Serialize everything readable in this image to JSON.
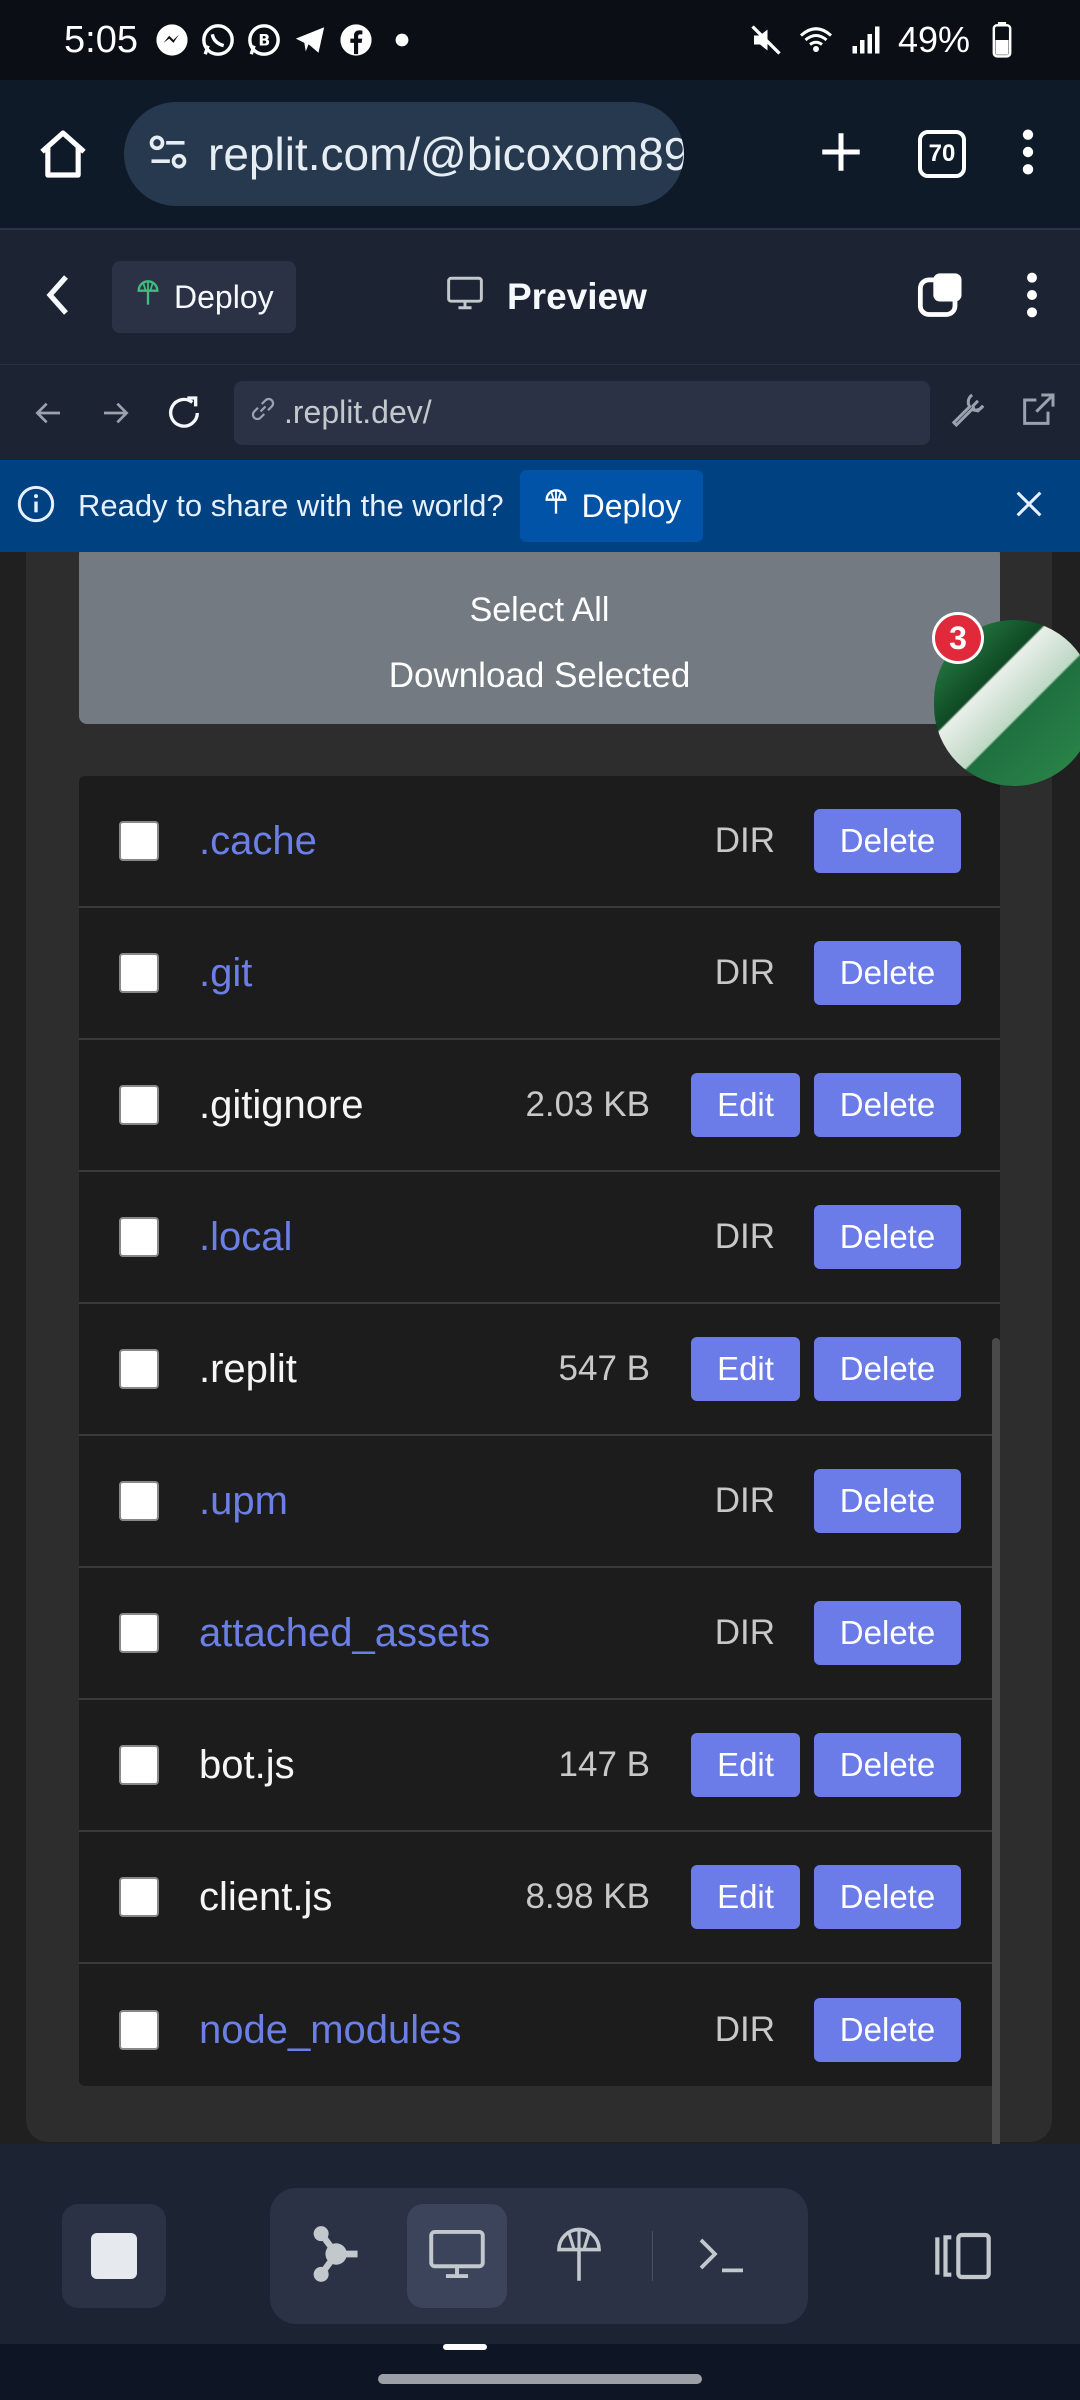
{
  "status_bar": {
    "time": "5:05",
    "battery": "49%",
    "left_icons": [
      "messenger-icon",
      "whatsapp-icon",
      "whatsapp-business-icon",
      "telegram-icon",
      "facebook-icon",
      "dot-icon"
    ],
    "right_icons": [
      "mute-icon",
      "wifi-icon",
      "signal-icon",
      "battery-icon"
    ]
  },
  "browser": {
    "url": "replit.com/@bicoxom89",
    "tab_count": "70"
  },
  "replit_header": {
    "deploy_label": "Deploy",
    "preview_label": "Preview"
  },
  "nav_bar": {
    "address": ".replit.dev/"
  },
  "banner": {
    "text": "Ready to share with the world?",
    "deploy_label": "Deploy"
  },
  "page": {
    "select_all_label": "Select All",
    "download_label": "Download Selected",
    "files": [
      {
        "name": ".cache",
        "type": "dir",
        "size": "DIR",
        "editable": false,
        "delete_label": "Delete"
      },
      {
        "name": ".git",
        "type": "dir",
        "size": "DIR",
        "editable": false,
        "delete_label": "Delete"
      },
      {
        "name": ".gitignore",
        "type": "file",
        "size": "2.03 KB",
        "editable": true,
        "edit_label": "Edit",
        "delete_label": "Delete"
      },
      {
        "name": ".local",
        "type": "dir",
        "size": "DIR",
        "editable": false,
        "delete_label": "Delete"
      },
      {
        "name": ".replit",
        "type": "file",
        "size": "547 B",
        "editable": true,
        "edit_label": "Edit",
        "delete_label": "Delete"
      },
      {
        "name": ".upm",
        "type": "dir",
        "size": "DIR",
        "editable": false,
        "delete_label": "Delete"
      },
      {
        "name": "attached_assets",
        "type": "dir",
        "size": "DIR",
        "editable": false,
        "delete_label": "Delete"
      },
      {
        "name": "bot.js",
        "type": "file",
        "size": "147 B",
        "editable": true,
        "edit_label": "Edit",
        "delete_label": "Delete"
      },
      {
        "name": "client.js",
        "type": "file",
        "size": "8.98 KB",
        "editable": true,
        "edit_label": "Edit",
        "delete_label": "Delete"
      },
      {
        "name": "node_modules",
        "type": "dir",
        "size": "DIR",
        "editable": false,
        "delete_label": "Delete"
      }
    ]
  },
  "bubble": {
    "badge_count": "3"
  },
  "colors": {
    "accent": "#6b7be8",
    "dir_link": "#6b7fe6",
    "banner": "#004182",
    "notification": "#e02a3c"
  }
}
